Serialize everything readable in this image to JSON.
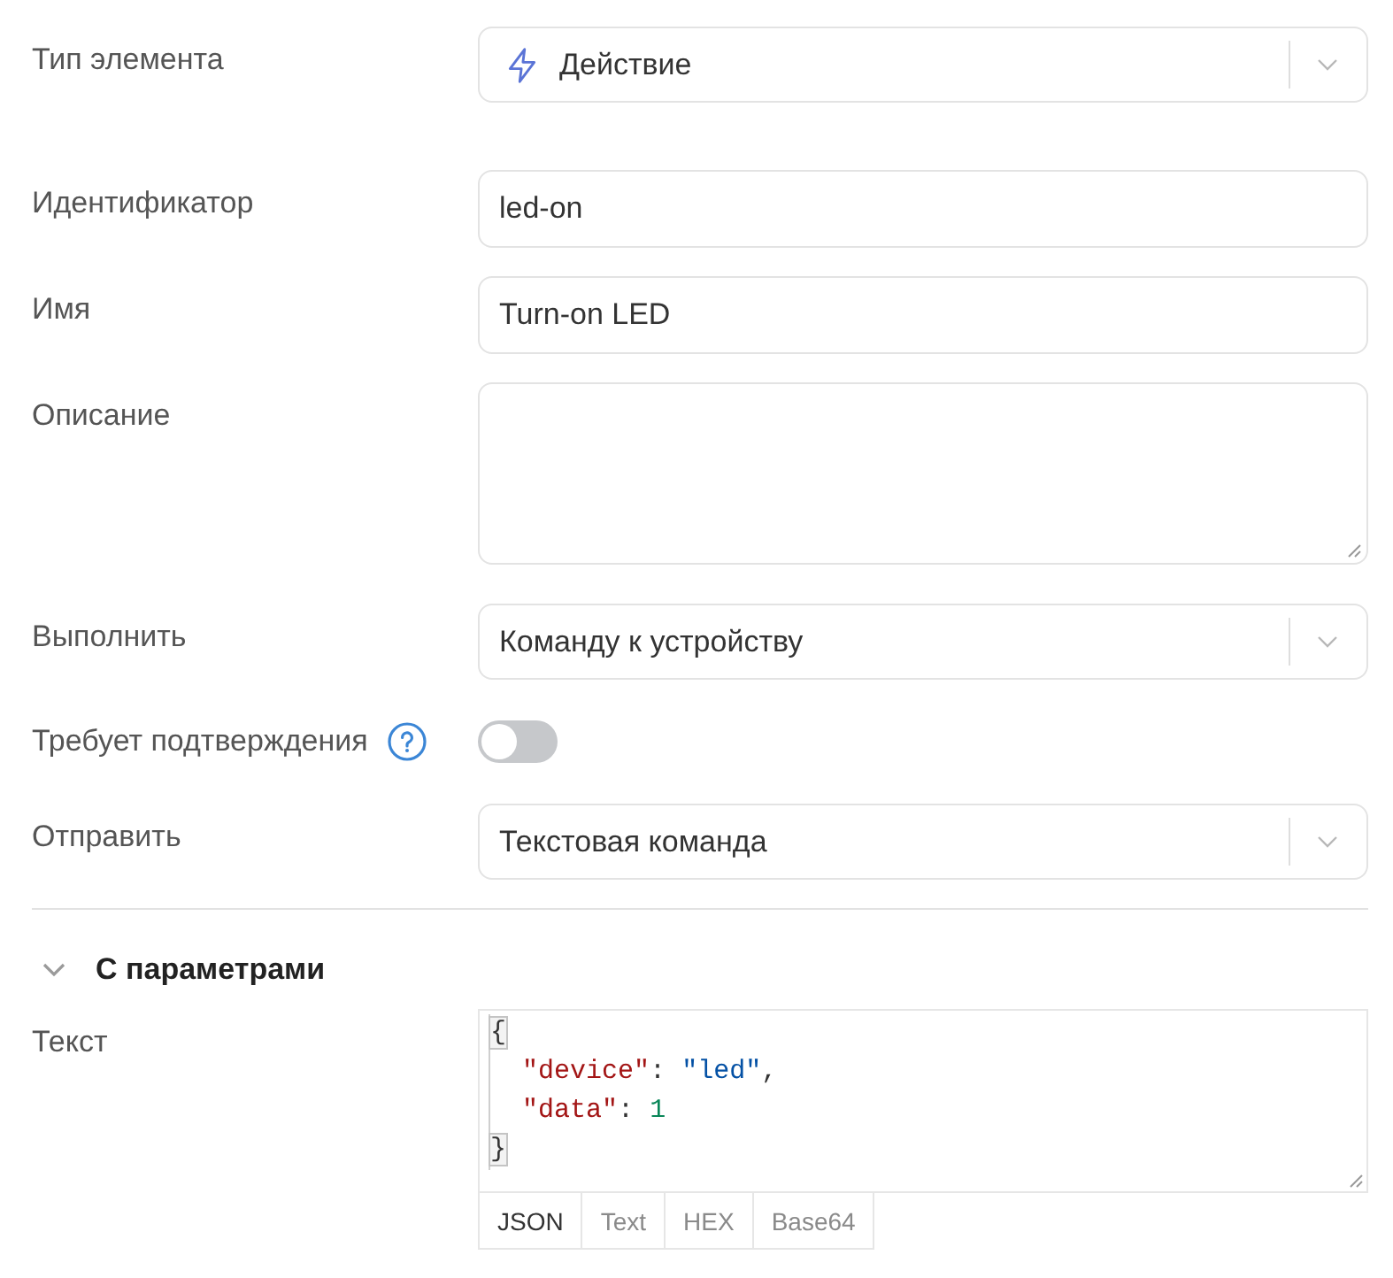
{
  "groups": [
    [
      {
        "kind": "select",
        "label": "Тип элемента",
        "value": "Действие",
        "icon": true
      }
    ],
    [
      {
        "kind": "input",
        "label": "Идентификатор",
        "value": "led-on"
      },
      {
        "kind": "input",
        "label": "Имя",
        "value": "Turn-on LED"
      },
      {
        "kind": "textarea",
        "label": "Описание"
      },
      {
        "kind": "select",
        "label": "Выполнить",
        "value": "Команду к устройству"
      },
      {
        "kind": "toggle",
        "label": "Требует подтверждения",
        "help": true,
        "on": false
      },
      {
        "kind": "select",
        "label": "Отправить",
        "value": "Текстовая команда"
      }
    ]
  ],
  "section": {
    "title": "С параметрами",
    "expanded": true,
    "fields": [
      {
        "kind": "code",
        "label": "Текст",
        "lines": [
          {
            "text": "{",
            "highlighted": true
          },
          {
            "text": "  \"device\": \"led\",",
            "highlighted": false
          },
          {
            "text": "  \"data\": 1",
            "highlighted": false
          },
          {
            "text": "}",
            "highlighted": true
          }
        ],
        "formats": [
          {
            "label": "JSON",
            "selected": true
          },
          {
            "label": "Text",
            "selected": false
          },
          {
            "label": "HEX",
            "selected": false
          },
          {
            "label": "Base64",
            "selected": false
          }
        ]
      }
    ]
  }
}
